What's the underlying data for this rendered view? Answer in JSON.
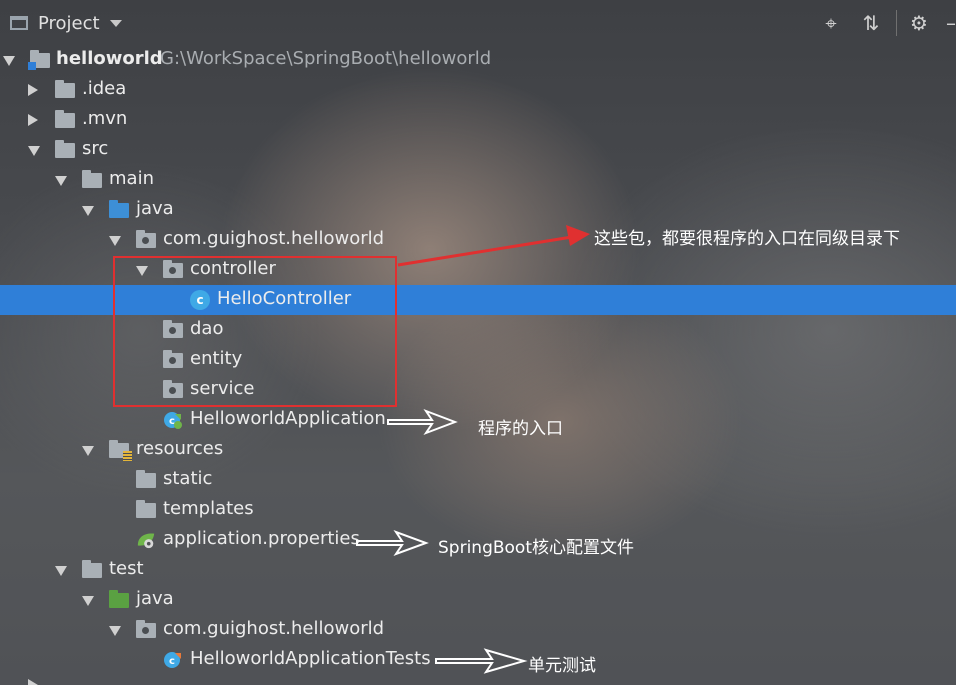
{
  "panel": {
    "title": "Project",
    "toolbar_icons": [
      "crosshair-icon",
      "collapse-icon",
      "gear-icon",
      "hide-icon"
    ]
  },
  "tree": [
    {
      "label": "helloworld",
      "path": "G:\\WorkSpace\\SpringBoot\\helloworld",
      "bold": true,
      "icon": "module-folder-icon",
      "expand": "down"
    },
    {
      "label": ".idea",
      "icon": "folder-icon",
      "expand": "right"
    },
    {
      "label": ".mvn",
      "icon": "folder-icon",
      "expand": "right"
    },
    {
      "label": "src",
      "icon": "folder-icon",
      "expand": "down"
    },
    {
      "label": "main",
      "icon": "folder-icon",
      "expand": "down"
    },
    {
      "label": "java",
      "icon": "source-folder-icon",
      "expand": "down"
    },
    {
      "label": "com.guighost.helloworld",
      "icon": "package-icon",
      "expand": "down"
    },
    {
      "label": "controller",
      "icon": "package-icon",
      "expand": "down"
    },
    {
      "label": "HelloController",
      "icon": "class-icon",
      "expand": "none",
      "selected": true
    },
    {
      "label": "dao",
      "icon": "package-icon",
      "expand": "none"
    },
    {
      "label": "entity",
      "icon": "package-icon",
      "expand": "none"
    },
    {
      "label": "service",
      "icon": "package-icon",
      "expand": "none"
    },
    {
      "label": "HelloworldApplication",
      "icon": "spring-boot-class-icon",
      "expand": "none"
    },
    {
      "label": "resources",
      "icon": "resources-folder-icon",
      "expand": "down"
    },
    {
      "label": "static",
      "icon": "folder-icon",
      "expand": "none"
    },
    {
      "label": "templates",
      "icon": "folder-icon",
      "expand": "none"
    },
    {
      "label": "application.properties",
      "icon": "spring-properties-icon",
      "expand": "none"
    },
    {
      "label": "test",
      "icon": "folder-icon",
      "expand": "down"
    },
    {
      "label": "java",
      "icon": "test-source-folder-icon",
      "expand": "down"
    },
    {
      "label": "com.guighost.helloworld",
      "icon": "package-icon",
      "expand": "down"
    },
    {
      "label": "HelloworldApplicationTests",
      "icon": "spring-boot-test-class-icon",
      "expand": "none"
    }
  ],
  "annotations": {
    "packages_note": "这些包，都要很程序的入口在同级目录下",
    "entry_note": "程序的入口",
    "config_note": "SpringBoot核心配置文件",
    "test_note": "单元测试"
  },
  "colors": {
    "selection": "#2f7fd8",
    "red_annotation": "#e03030",
    "source_folder": "#3d8fd6",
    "test_folder": "#5aa142"
  }
}
